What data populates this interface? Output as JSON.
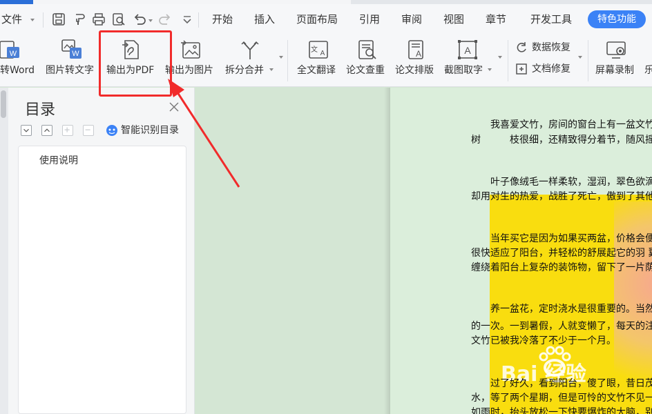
{
  "menu": {
    "file": "文件",
    "tabs": [
      "开始",
      "插入",
      "页面布局",
      "引用",
      "审阅",
      "视图",
      "章节",
      "开发工具"
    ],
    "special": "特色功能"
  },
  "ribbon": {
    "to_word": "转Word",
    "img_to_text": "图片转文字",
    "export_pdf": "输出为PDF",
    "export_img": "输出为图片",
    "split_merge": "拆分合并",
    "translate": "全文翻译",
    "plagiarism": "论文查重",
    "paper_layout": "论文排版",
    "screenshot_text": "截图取字",
    "data_recovery": "数据恢复",
    "doc_repair": "文档修复",
    "screen_record": "屏幕录制",
    "cut_label": "乐"
  },
  "toc": {
    "title": "目录",
    "smart_label": "智能识别目录",
    "entry": "使用说明"
  },
  "doc": {
    "lines": [
      "我喜爱文竹，房间的窗台上有一盆文竹",
      "树　　　枝很细，还精致得分着节，随风摇",
      "叶子像绒毛一样柔软，湿润，翠色欲滴，",
      "却用对生的热爱，战胜了死亡，傲到了其他",
      "当年买它是因为如果买两盆，价格会便",
      "很快适应了阳台，并轻松的舒展起它的羽 翼",
      "缠绕着阳台上复杂的装饰物，留下了一片荫",
      "养一盆花，定时浇水是很重要的。当然",
      "的一次。一到暑假，人就变懒了，每天的注",
      "文竹已被我冷落了不少于一个月。",
      "过了好久，看到阳台，傻了眼，昔日茂",
      "水，等了两个星期，但是可怜的文竹不见一",
      "如雨时，抬头放松一下快要爆炸的大脑，别"
    ],
    "watermark": "Bai 经验"
  }
}
